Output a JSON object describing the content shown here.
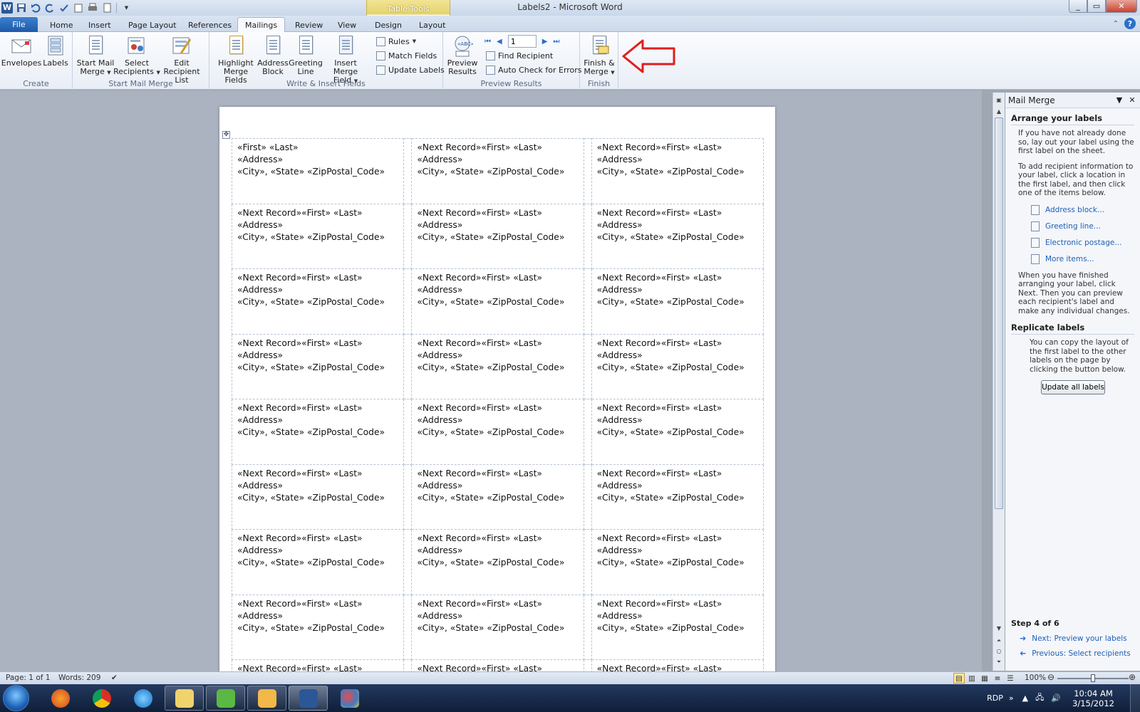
{
  "window": {
    "title": "Labels2 - Microsoft Word",
    "logo_letter": "W"
  },
  "contextual": {
    "label": "Table Tools"
  },
  "tabs": [
    {
      "label": "File"
    },
    {
      "label": "Home"
    },
    {
      "label": "Insert"
    },
    {
      "label": "Page Layout"
    },
    {
      "label": "References"
    },
    {
      "label": "Mailings"
    },
    {
      "label": "Review"
    },
    {
      "label": "View"
    },
    {
      "label": "Design"
    },
    {
      "label": "Layout"
    }
  ],
  "ribbon": {
    "create": {
      "label": "Create",
      "envelopes": "Envelopes",
      "labels": "Labels"
    },
    "start": {
      "label": "Start Mail Merge",
      "start_l1": "Start Mail",
      "start_l2": "Merge",
      "select_l1": "Select",
      "select_l2": "Recipients",
      "edit_l1": "Edit",
      "edit_l2": "Recipient List"
    },
    "write": {
      "label": "Write & Insert Fields",
      "highlight_l1": "Highlight",
      "highlight_l2": "Merge Fields",
      "address_l1": "Address",
      "address_l2": "Block",
      "greeting_l1": "Greeting",
      "greeting_l2": "Line",
      "insert_l1": "Insert Merge",
      "insert_l2": "Field",
      "rules": "Rules",
      "match": "Match Fields",
      "update": "Update Labels"
    },
    "preview": {
      "label": "Preview Results",
      "preview_l1": "Preview",
      "preview_l2": "Results",
      "record": "1",
      "find": "Find Recipient",
      "auto": "Auto Check for Errors"
    },
    "finish": {
      "label": "Finish",
      "finish_l1": "Finish &",
      "finish_l2": "Merge"
    }
  },
  "labels": {
    "first": {
      "line1": "«First» «Last»",
      "line2": "«Address»",
      "line3": "«City», «State» «ZipPostal_Code»"
    },
    "next": {
      "line1": "«Next Record»«First» «Last»",
      "line2": "«Address»",
      "line3": "«City», «State» «ZipPostal_Code»"
    }
  },
  "pane": {
    "title": "Mail Merge",
    "arrange_heading": "Arrange your labels",
    "arrange_p1": "If you have not already done so, lay out your label using the first label on the sheet.",
    "arrange_p2": "To add recipient information to your label, click a location in the first label, and then click one of the items below.",
    "links": [
      "Address block...",
      "Greeting line...",
      "Electronic postage...",
      "More items..."
    ],
    "arrange_p3": "When you have finished arranging your label, click Next. Then you can preview each recipient's label and make any individual changes.",
    "replicate_heading": "Replicate labels",
    "replicate_p": "You can copy the layout of the first label to the other labels on the page by clicking the button below.",
    "update_button": "Update all labels",
    "step": "Step 4 of 6",
    "next_link": "Next: Preview your labels",
    "prev_link": "Previous: Select recipients"
  },
  "status": {
    "page": "Page: 1 of 1",
    "words": "Words: 209",
    "zoom": "100%"
  },
  "taskbar": {
    "lang": "RDP",
    "time": "10:04 AM",
    "date": "3/15/2012"
  },
  "colors": {
    "annotation_arrow": "#e01e1e",
    "file_tab": "#2a66bb",
    "table_tools": "#e5d36b"
  }
}
